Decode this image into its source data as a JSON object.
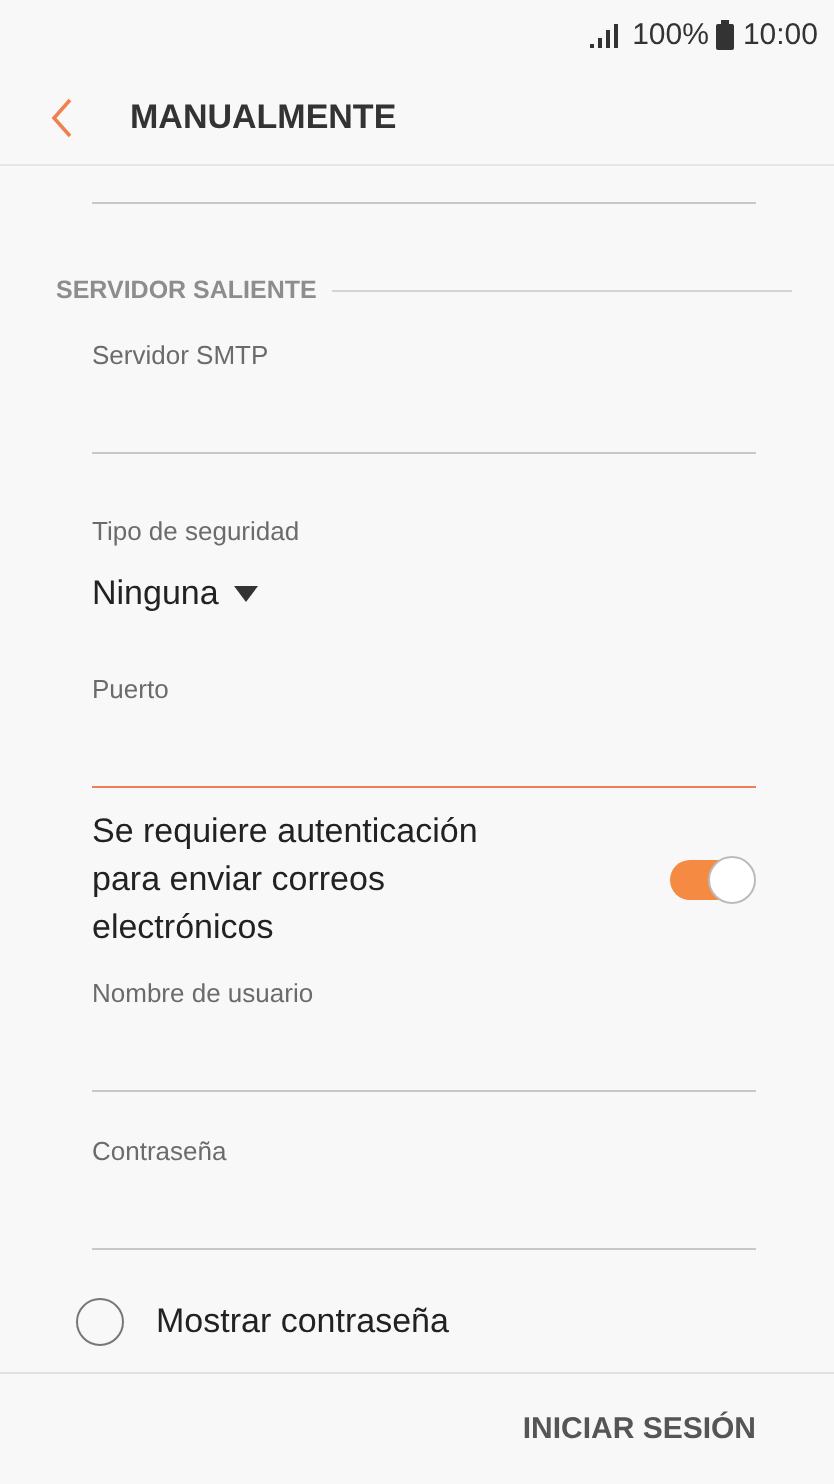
{
  "status_bar": {
    "battery": "100%",
    "time": "10:00"
  },
  "app_bar": {
    "title": "MANUALMENTE"
  },
  "section": {
    "title": "SERVIDOR SALIENTE"
  },
  "fields": [
    {
      "kind": "text",
      "label": "Servidor SMTP",
      "focused": false
    },
    {
      "kind": "dropdown",
      "label": "Tipo de seguridad",
      "value": "Ninguna"
    },
    {
      "kind": "text",
      "label": "Puerto",
      "focused": true
    },
    {
      "kind": "toggle",
      "label": "Se requiere autenticación para enviar correos electrónicos",
      "on": true
    },
    {
      "kind": "text",
      "label": "Nombre de usuario",
      "focused": false
    },
    {
      "kind": "text",
      "label": "Contraseña",
      "focused": false
    }
  ],
  "show_password": {
    "label": "Mostrar contraseña",
    "checked": false
  },
  "footer": {
    "button": "INICIAR SESIÓN"
  }
}
